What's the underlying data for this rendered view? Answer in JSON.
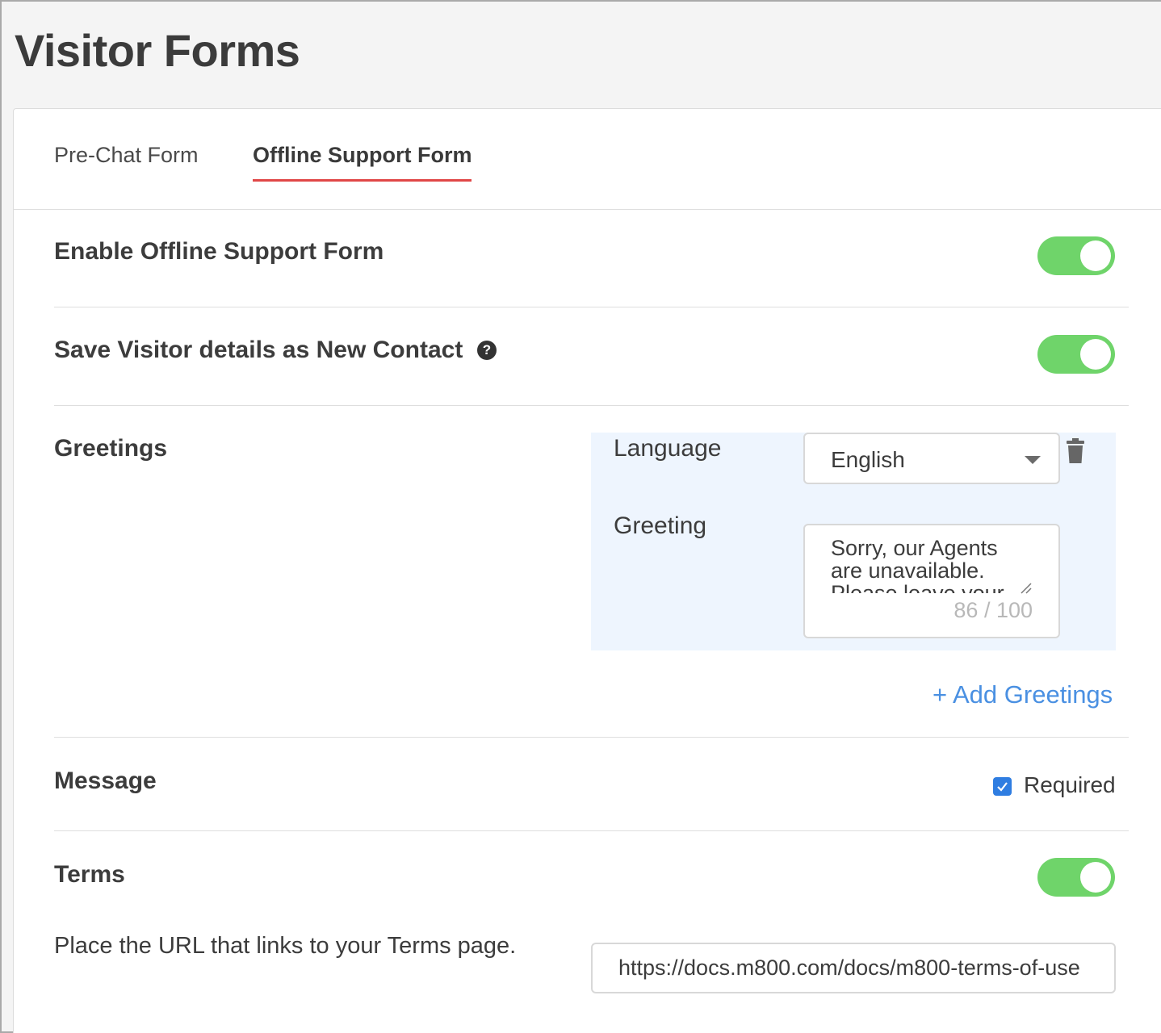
{
  "page": {
    "title": "Visitor Forms"
  },
  "tabs": [
    {
      "label": "Pre-Chat Form",
      "active": false
    },
    {
      "label": "Offline Support Form",
      "active": true
    }
  ],
  "enable_offline": {
    "label": "Enable Offline Support Form",
    "enabled": true
  },
  "save_visitor": {
    "label": "Save Visitor details as New Contact",
    "help_icon": "question-circle-icon",
    "enabled": true
  },
  "greetings": {
    "section_label": "Greetings",
    "language_label": "Language",
    "language_value": "English",
    "greeting_label": "Greeting",
    "greeting_text": "Sorry, our Agents are unavailable. Please leave your",
    "char_count": "86 / 100",
    "add_label": "+ Add Greetings"
  },
  "message": {
    "label": "Message",
    "required_label": "Required",
    "required_checked": true
  },
  "terms": {
    "label": "Terms",
    "enabled": true,
    "description": "Place the URL that links to your Terms page.",
    "url_value": "https://docs.m800.com/docs/m800-terms-of-use"
  },
  "colors": {
    "toggle_on": "#6fd46a",
    "link": "#4a90e2",
    "tab_underline": "#e04747",
    "checkbox": "#2f7de1"
  }
}
